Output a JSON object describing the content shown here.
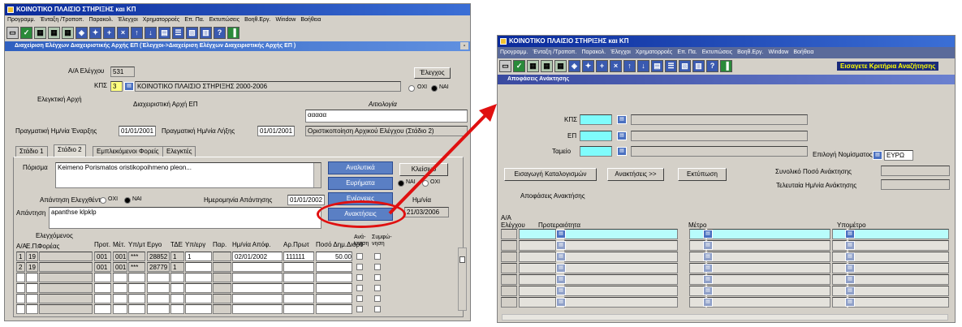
{
  "left": {
    "title": "ΚΟΙΝΟΤΙΚΟ ΠΛΑΙΣΙΟ ΣΤΗΡΙΞΗΣ και ΚΠ",
    "menu": [
      "Προγραμμ.",
      "Ένταξη /Τροποπ.",
      "Παρακολ.",
      "Έλεγχοι",
      "Χρηματορροές",
      "Επ. Πα.",
      "Εκτυπώσεις",
      "Βοηθ.Εργ.",
      "Window",
      "Βοήθεια"
    ],
    "subtitle": "Διαχείριση Ελέγχων Διαχειριστικής Αρχής ΕΠ (Έλεγχοι->Διαχείριση Ελέγχων Διαχειριστικής Αρχής ΕΠ )",
    "aa_label": "Α/Α Ελέγχου",
    "aa_value": "531",
    "elegxos_btn": "Έλεγχος",
    "kps_label": "ΚΠΣ",
    "kps_value": "3",
    "kps_desc": "ΚΟΙΝΟΤΙΚΟ ΠΛΑΙΣΙΟ ΣΤΗΡΙΞΗΣ 2000-2006",
    "radio_ochi": "ΟΧΙ",
    "radio_nai": "ΝΑΙ",
    "elegktiki_label": "Ελεγκτική Αρχή",
    "diax_label": "Διαχειριστική Αρχή ΕΠ",
    "aitiologia_label": "Αιτιολογία",
    "aitiologia_value": "ααααα",
    "start_label": "Πραγματική Ημ/νία Έναρξης",
    "start_value": "01/01/2001",
    "end_label": "Πραγματική Ημ/νία Λήξης",
    "end_value": "01/01/2001",
    "status_value": "Οριστικοποίηση Αρχικού Ελέγχου (Στάδιο 2)",
    "tabs": [
      "Στάδιο 1",
      "Στάδιο 2",
      "Εμπλεκόμενοι Φορείς",
      "Ελεγκτές"
    ],
    "porisma_label": "Πόρισμα",
    "porisma_value": "Keimeno Porismatos oristikopoihmeno pleon...",
    "btn_analytika": "Αναλυτικά",
    "btn_evrimata": "Ευρήματα",
    "btn_energeies": "Ενέργειες",
    "btn_anaktiseis": "Ανακτήσεις",
    "btn_kleisimo": "Κλείσιμο",
    "apantisi_elegx_label": "Απάντηση Ελεγχθέντ",
    "date_apantisis_label": "Ημερομηνία Απάντησης",
    "date_apantisis_value": "01/01/2002",
    "hm_nia_label": "Ημ/νία",
    "hm_nia_value": "21/03/2006",
    "apantisi_label": "Απάντηση",
    "apantisi_value": "apanthse klpklp",
    "grid_caption": "Ελεγχόμενος",
    "grid_headers": [
      "Α/Α",
      "Ε.Π.",
      "Φορέας",
      "Προτ.",
      "Μέτ.",
      "Υπ/μτ",
      "Εργο",
      "ΤΔΕ",
      "Υπ/εργ",
      "Παρ.",
      "Ημ/νία Απόφ.",
      "Αρ.Πρωτ",
      "Ποσό Δημ.Διόρθ",
      "Ανά-κτηση",
      "Συμφώ-νηση"
    ],
    "rows": [
      {
        "aa": "1",
        "ep": "19",
        "prot": "001",
        "met": "001",
        "ypmt": "***",
        "ergo": "28852",
        "tde": "1",
        "ypergo": "1",
        "date": "02/01/2002",
        "arprot": "111111",
        "poso": "50.00"
      },
      {
        "aa": "2",
        "ep": "19",
        "prot": "001",
        "met": "001",
        "ypmt": "***",
        "ergo": "28779",
        "tde": "1",
        "ypergo": "",
        "date": "",
        "arprot": "",
        "poso": ""
      }
    ]
  },
  "right": {
    "title": "ΚΟΙΝΟΤΙΚΟ ΠΛΑΙΣΙΟ ΣΤΗΡΙΞΗΣ και ΚΠ",
    "menu": [
      "Προγραμμ.",
      "Ένταξη /Τροποπ.",
      "Παρακολ.",
      "Έλεγχοι",
      "Χρηματορροές",
      "Επ. Πα.",
      "Εκτυπώσεις",
      "Βοηθ.Εργ.",
      "Window",
      "Βοήθεια"
    ],
    "toolbar_hint": "Εισαγετε Κριτήρια Αναζήτησης",
    "subtitle": "Αποφάσεις Ανάκτησης",
    "kps_label": "ΚΠΣ",
    "ep_label": "ΕΠ",
    "tameio_label": "Ταμείο",
    "currency_label": "Επιλογή Νομίσματος",
    "currency_value": "ΕΥΡΩ",
    "btn_eisagogi": "Εισαγωγή Καταλογισμών",
    "btn_anaktiseis": "Ανακτήσεις >>",
    "btn_ektyposi": "Εκτύπωση",
    "total_label": "Συνολικό Ποσό Ανάκτησης",
    "last_date_label": "Τελευταία Ημ/νία Ανάκτησης",
    "decisions_label": "Αποφάσεις Ανακτήσης",
    "col_aa": "Α/Α Ελέγχου",
    "col_protereotita": "Προτεραιότητα",
    "col_metro": "Μέτρο",
    "col_ypometro": "Υπομέτρο"
  }
}
